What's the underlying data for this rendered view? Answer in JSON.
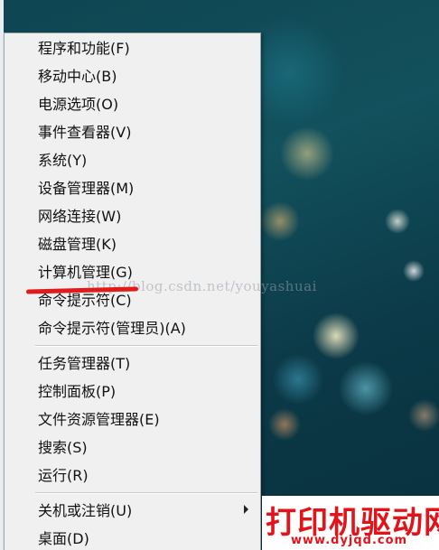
{
  "context_menu": {
    "items": [
      {
        "label": "程序和功能(F)"
      },
      {
        "label": "移动中心(B)"
      },
      {
        "label": "电源选项(O)"
      },
      {
        "label": "事件查看器(V)"
      },
      {
        "label": "系统(Y)"
      },
      {
        "label": "设备管理器(M)"
      },
      {
        "label": "网络连接(W)"
      },
      {
        "label": "磁盘管理(K)"
      },
      {
        "label": "计算机管理(G)"
      },
      {
        "label": "命令提示符(C)"
      },
      {
        "label": "命令提示符(管理员)(A)"
      },
      {
        "label": "任务管理器(T)"
      },
      {
        "label": "控制面板(P)"
      },
      {
        "label": "文件资源管理器(E)"
      },
      {
        "label": "搜索(S)"
      },
      {
        "label": "运行(R)"
      },
      {
        "label": "关机或注销(U)"
      },
      {
        "label": "桌面(D)"
      }
    ]
  },
  "annotation": {
    "color": "#e11b1b",
    "target": "计算机管理(G)"
  },
  "watermark_text": "http://blog.csdn.net/youyashuai",
  "brand_logo": {
    "title": "打印机驱动网",
    "url": "www.dyjqd.com",
    "color": "#e2141a"
  },
  "icons": {
    "submenu_arrow": "chevron-right-icon"
  }
}
